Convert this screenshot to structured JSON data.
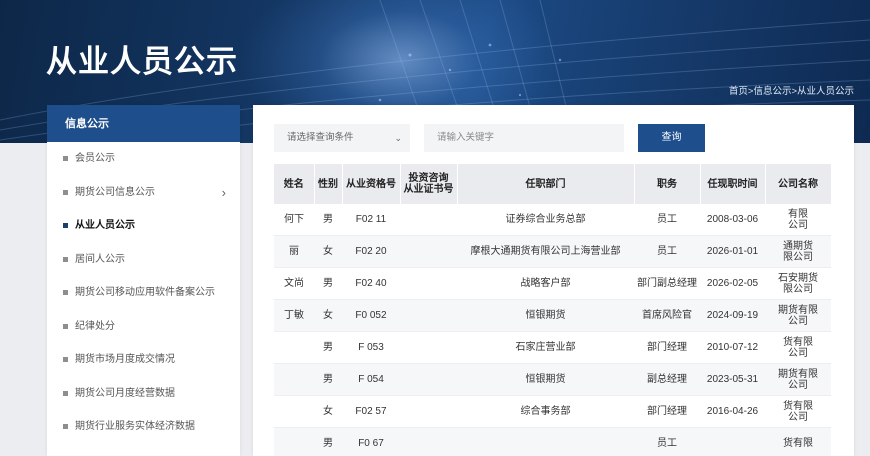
{
  "header": {
    "title": "从业人员公示",
    "breadcrumb": "首页>信息公示>从业人员公示"
  },
  "sidebar": {
    "heading": "信息公示",
    "items": [
      {
        "label": "会员公示"
      },
      {
        "label": "期货公司信息公示"
      },
      {
        "label": "从业人员公示"
      },
      {
        "label": "居间人公示"
      },
      {
        "label": "期货公司移动应用软件备案公示"
      },
      {
        "label": "纪律处分"
      },
      {
        "label": "期货市场月度成交情况"
      },
      {
        "label": "期货公司月度经营数据"
      },
      {
        "label": "期货行业服务实体经济数据"
      }
    ],
    "active_index": 2
  },
  "search": {
    "select_value": "请选择查询条件",
    "keyword_placeholder": "请输入关键字",
    "button_label": "查询"
  },
  "table": {
    "headers": [
      "姓名",
      "性别",
      "从业资格号",
      "投资咨询\n从业证书号",
      "任职部门",
      "职务",
      "任现职时间",
      "公司名称"
    ],
    "rows": [
      {
        "name": "何下",
        "gender": "男",
        "cert": "F02  11",
        "advisory": "",
        "dept": "证券综合业务总部",
        "title": "员工",
        "date": "2008-03-06",
        "company": "有限\n公司"
      },
      {
        "name": "丽",
        "gender": "女",
        "cert": "F02  20",
        "advisory": "",
        "dept": "摩根大通期货有限公司上海营业部",
        "title": "员工",
        "date": "2026-01-01",
        "company": "通期货\n限公司"
      },
      {
        "name": "文尚",
        "gender": "男",
        "cert": "F02  40",
        "advisory": "",
        "dept": "战略客户部",
        "title": "部门副总经理",
        "date": "2026-02-05",
        "company": "石安期货\n限公司"
      },
      {
        "name": "丁敏",
        "gender": "女",
        "cert": "F0  052",
        "advisory": "",
        "dept": "恒银期货",
        "title": "首席风险官",
        "date": "2024-09-19",
        "company": "期货有限\n公司"
      },
      {
        "name": "",
        "gender": "男",
        "cert": "F  053",
        "advisory": "",
        "dept": "石家庄营业部",
        "title": "部门经理",
        "date": "2010-07-12",
        "company": "货有限\n公司"
      },
      {
        "name": "",
        "gender": "男",
        "cert": "F  054",
        "advisory": "",
        "dept": "恒银期货",
        "title": "副总经理",
        "date": "2023-05-31",
        "company": "期货有限\n公司"
      },
      {
        "name": "",
        "gender": "女",
        "cert": "F02  57",
        "advisory": "",
        "dept": "综合事务部",
        "title": "部门经理",
        "date": "2016-04-26",
        "company": "货有限\n公司"
      },
      {
        "name": "",
        "gender": "男",
        "cert": "F0  67",
        "advisory": "",
        "dept": "",
        "title": "员工",
        "date": "",
        "company": "货有限"
      }
    ]
  },
  "colors": {
    "primary": "#1e4f8c",
    "banner_dark": "#0d2748",
    "header_row": "#e9ebee",
    "page_bg": "#ecedf0"
  }
}
